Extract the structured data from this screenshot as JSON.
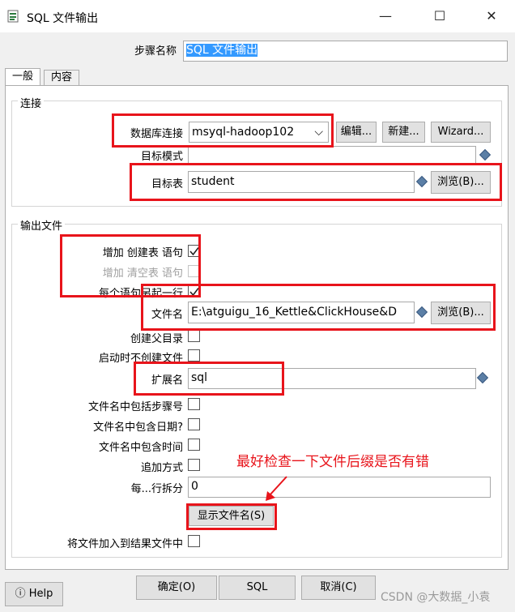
{
  "window": {
    "title": "SQL 文件输出"
  },
  "step_name": {
    "label": "步骤名称",
    "value": "SQL 文件输出"
  },
  "tabs": [
    {
      "label": "一般"
    },
    {
      "label": "内容"
    }
  ],
  "connection": {
    "group_label": "连接",
    "db_label": "数据库连接",
    "db_value": "msyql-hadoop102",
    "edit_btn": "编辑...",
    "new_btn": "新建...",
    "wizard_btn": "Wizard...",
    "schema_label": "目标模式",
    "schema_value": "",
    "table_label": "目标表",
    "table_value": "student",
    "browse_btn": "浏览(B)..."
  },
  "output": {
    "group_label": "输出文件",
    "add_create_label": "增加 创建表 语句",
    "add_truncate_label": "增加 清空表 语句",
    "each_stmt_label": "每个语句另起一行",
    "filename_label": "文件名",
    "filename_value": "E:\\atguigu_16_Kettle&ClickHouse&D",
    "browse_btn": "浏览(B)...",
    "create_parent_label": "创建父目录",
    "no_create_label": "启动时不创建文件",
    "ext_label": "扩展名",
    "ext_value": "sql",
    "include_step_label": "文件名中包括步骤号",
    "include_date_label": "文件名中包含日期?",
    "include_time_label": "文件名中包含时间",
    "append_label": "追加方式",
    "split_label": "每...行拆分",
    "split_value": "0",
    "show_files_btn": "显示文件名(S)",
    "add_to_result_label": "将文件加入到结果文件中"
  },
  "annotation": {
    "text": "最好检查一下文件后缀是否有错",
    "color": "#e8141b"
  },
  "footer": {
    "help_label": "Help",
    "ok_btn": "确定(O)",
    "sql_btn": "SQL",
    "cancel_btn": "取消(C)",
    "watermark": "CSDN @大数据_小袁"
  }
}
